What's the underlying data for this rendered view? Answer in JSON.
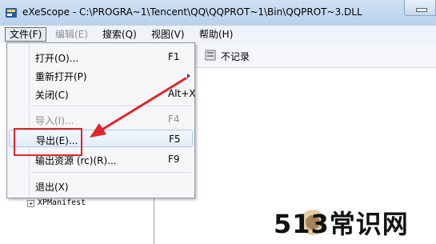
{
  "window": {
    "title": "eXeScope - C:\\PROGRA~1\\Tencent\\QQ\\QQPROT~1\\Bin\\QQPROT~3.DLL"
  },
  "menubar": {
    "items": [
      {
        "label": "文件(F)",
        "state": "active"
      },
      {
        "label": "编辑(E)",
        "state": "disabled"
      },
      {
        "label": "搜索(Q)",
        "state": "normal"
      },
      {
        "label": "视图(V)",
        "state": "normal"
      },
      {
        "label": "帮助(H)",
        "state": "normal"
      }
    ]
  },
  "file_menu": {
    "items": [
      {
        "label": "打开(O)...",
        "shortcut": "F1",
        "enabled": true
      },
      {
        "label": "重新打开(P)",
        "shortcut": "",
        "enabled": true,
        "submenu": true
      },
      {
        "label": "关闭(C)",
        "shortcut": "Alt+X",
        "enabled": true
      },
      {
        "label": "导入(I)...",
        "shortcut": "F4",
        "enabled": false
      },
      {
        "label": "导出(E)...",
        "shortcut": "F5",
        "enabled": true,
        "highlighted": true
      },
      {
        "label": "输出资源 (rc)(R)...",
        "shortcut": "F9",
        "enabled": true
      },
      {
        "label": "退出(X)",
        "shortcut": "",
        "enabled": true
      }
    ]
  },
  "toolbar": {
    "record_label": "不记录"
  },
  "tree": {
    "node_label": "XPManifest",
    "expander": "+"
  },
  "watermark": {
    "text": "513常识网"
  },
  "colors": {
    "annotation_red": "#e0262b",
    "highlight_border": "#a8c6ea",
    "titlebar": "#c7daf0"
  }
}
